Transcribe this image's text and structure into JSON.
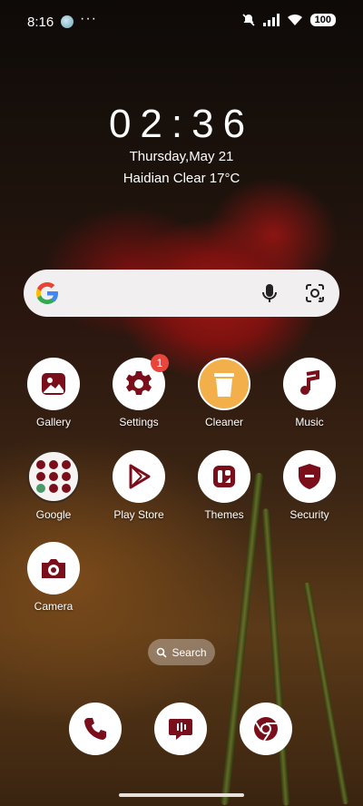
{
  "status": {
    "time": "8:16",
    "more": "···",
    "battery": "100"
  },
  "lockinfo": {
    "clock": "02:36",
    "date": "Thursday,May 21",
    "weather": "Haidian Clear 17°C"
  },
  "apps": [
    {
      "label": "Gallery"
    },
    {
      "label": "Settings",
      "badge": "1"
    },
    {
      "label": "Cleaner"
    },
    {
      "label": "Music"
    },
    {
      "label": "Google"
    },
    {
      "label": "Play Store"
    },
    {
      "label": "Themes"
    },
    {
      "label": "Security"
    },
    {
      "label": "Camera"
    }
  ],
  "search_pill": {
    "label": "Search"
  },
  "colors": {
    "icon_accent": "#7a0f1b",
    "cleaner_bg": "#f3b04a",
    "badge": "#e8453c"
  },
  "icons": {
    "dock": [
      "phone-icon",
      "messages-icon",
      "chrome-icon"
    ]
  }
}
